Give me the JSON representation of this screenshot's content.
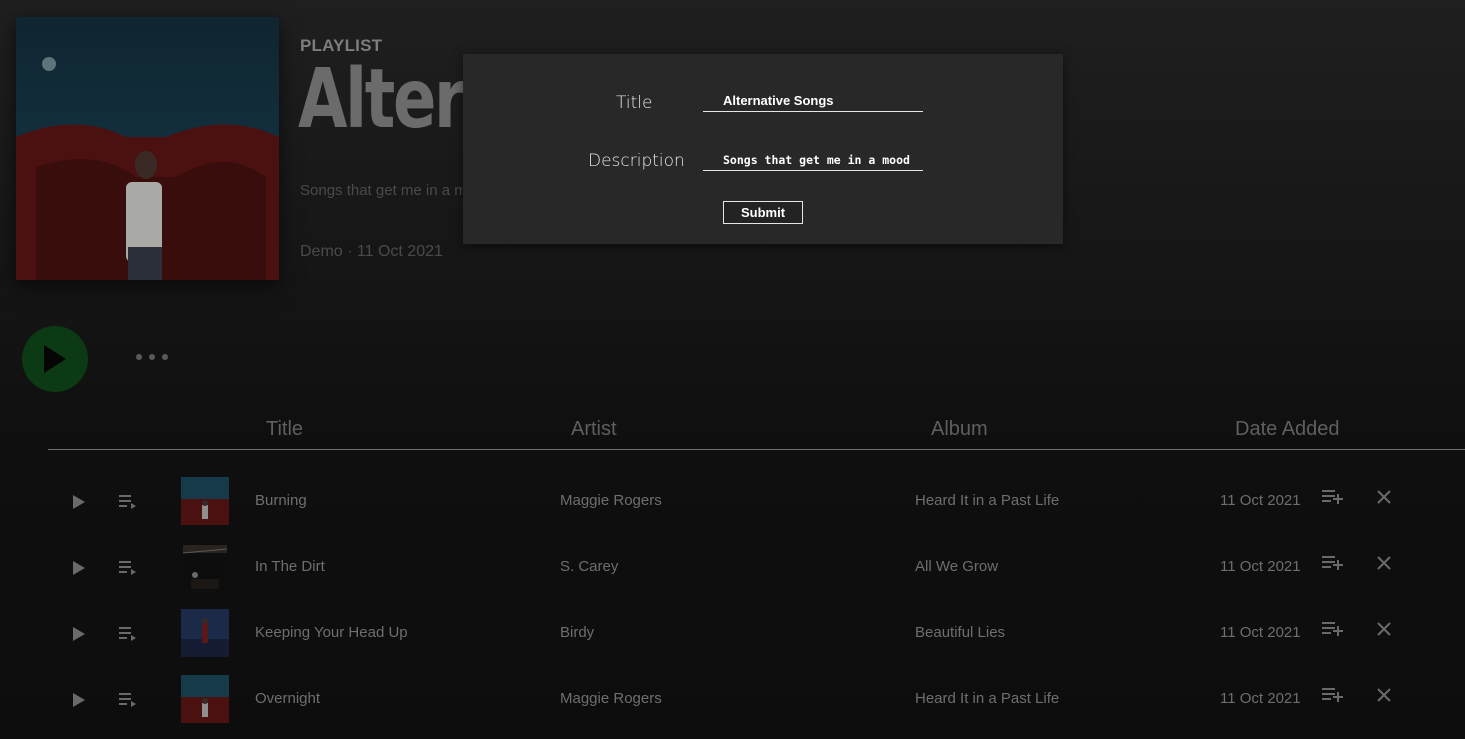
{
  "header": {
    "type_label": "PLAYLIST",
    "title": "Alternative Songs",
    "description": "Songs that get me in a mood",
    "meta": "Demo · 11 Oct 2021"
  },
  "table": {
    "headers": {
      "title": "Title",
      "artist": "Artist",
      "album": "Album",
      "date": "Date Added"
    },
    "rows": [
      {
        "title": "Burning",
        "artist": "Maggie Rogers",
        "album": "Heard It in a Past Life",
        "date": "11 Oct 2021"
      },
      {
        "title": "In The Dirt",
        "artist": "S. Carey",
        "album": "All We Grow",
        "date": "11 Oct 2021"
      },
      {
        "title": "Keeping Your Head Up",
        "artist": "Birdy",
        "album": "Beautiful Lies",
        "date": "11 Oct 2021"
      },
      {
        "title": "Overnight",
        "artist": "Maggie Rogers",
        "album": "Heard It in a Past Life",
        "date": "11 Oct 2021"
      }
    ]
  },
  "modal": {
    "title_label": "Title",
    "title_value": "Alternative Songs",
    "description_label": "Description",
    "description_value": "Songs that get me in a mood",
    "submit_label": "Submit"
  },
  "icons": {
    "play": "play-icon",
    "queue": "add-to-queue-icon",
    "add": "playlist-add-icon",
    "remove": "close-icon",
    "more": "more-horizontal-icon"
  },
  "colors": {
    "accent_green": "#0b3a14",
    "modal_bg": "#282828"
  }
}
